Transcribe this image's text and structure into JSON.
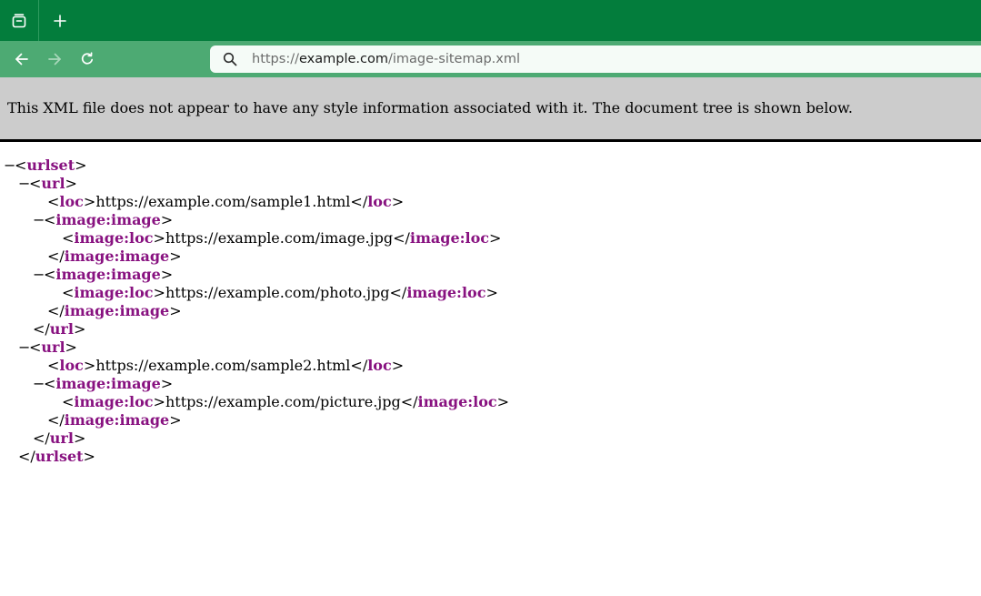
{
  "browser": {
    "tab_overview_icon": "tab-overview-icon",
    "new_tab_icon": "plus-icon",
    "nav": {
      "back_icon": "arrow-left-icon",
      "forward_icon": "arrow-right-icon",
      "reload_icon": "reload-icon"
    },
    "address": {
      "scheme": "https://",
      "host": "example.com",
      "path": "/image-sitemap.xml",
      "search_icon": "search-icon"
    },
    "colors": {
      "tabstrip": "#037d3c",
      "toolbar": "#4daa73",
      "urlbar": "#f5fbf7"
    }
  },
  "notice": {
    "text": "This XML file does not appear to have any style information associated with it. The document tree is shown below."
  },
  "xml": {
    "colors": {
      "tag": "#881280",
      "text": "#000000"
    },
    "fold_marker": "−",
    "root_tag": "urlset",
    "url_tag": "url",
    "loc_tag": "loc",
    "image_tag": "image:image",
    "image_loc_tag": "image:loc",
    "urls": [
      {
        "loc": "https://example.com/sample1.html",
        "images": [
          "https://example.com/image.jpg",
          "https://example.com/photo.jpg"
        ]
      },
      {
        "loc": "https://example.com/sample2.html",
        "images": [
          "https://example.com/picture.jpg"
        ]
      }
    ]
  }
}
